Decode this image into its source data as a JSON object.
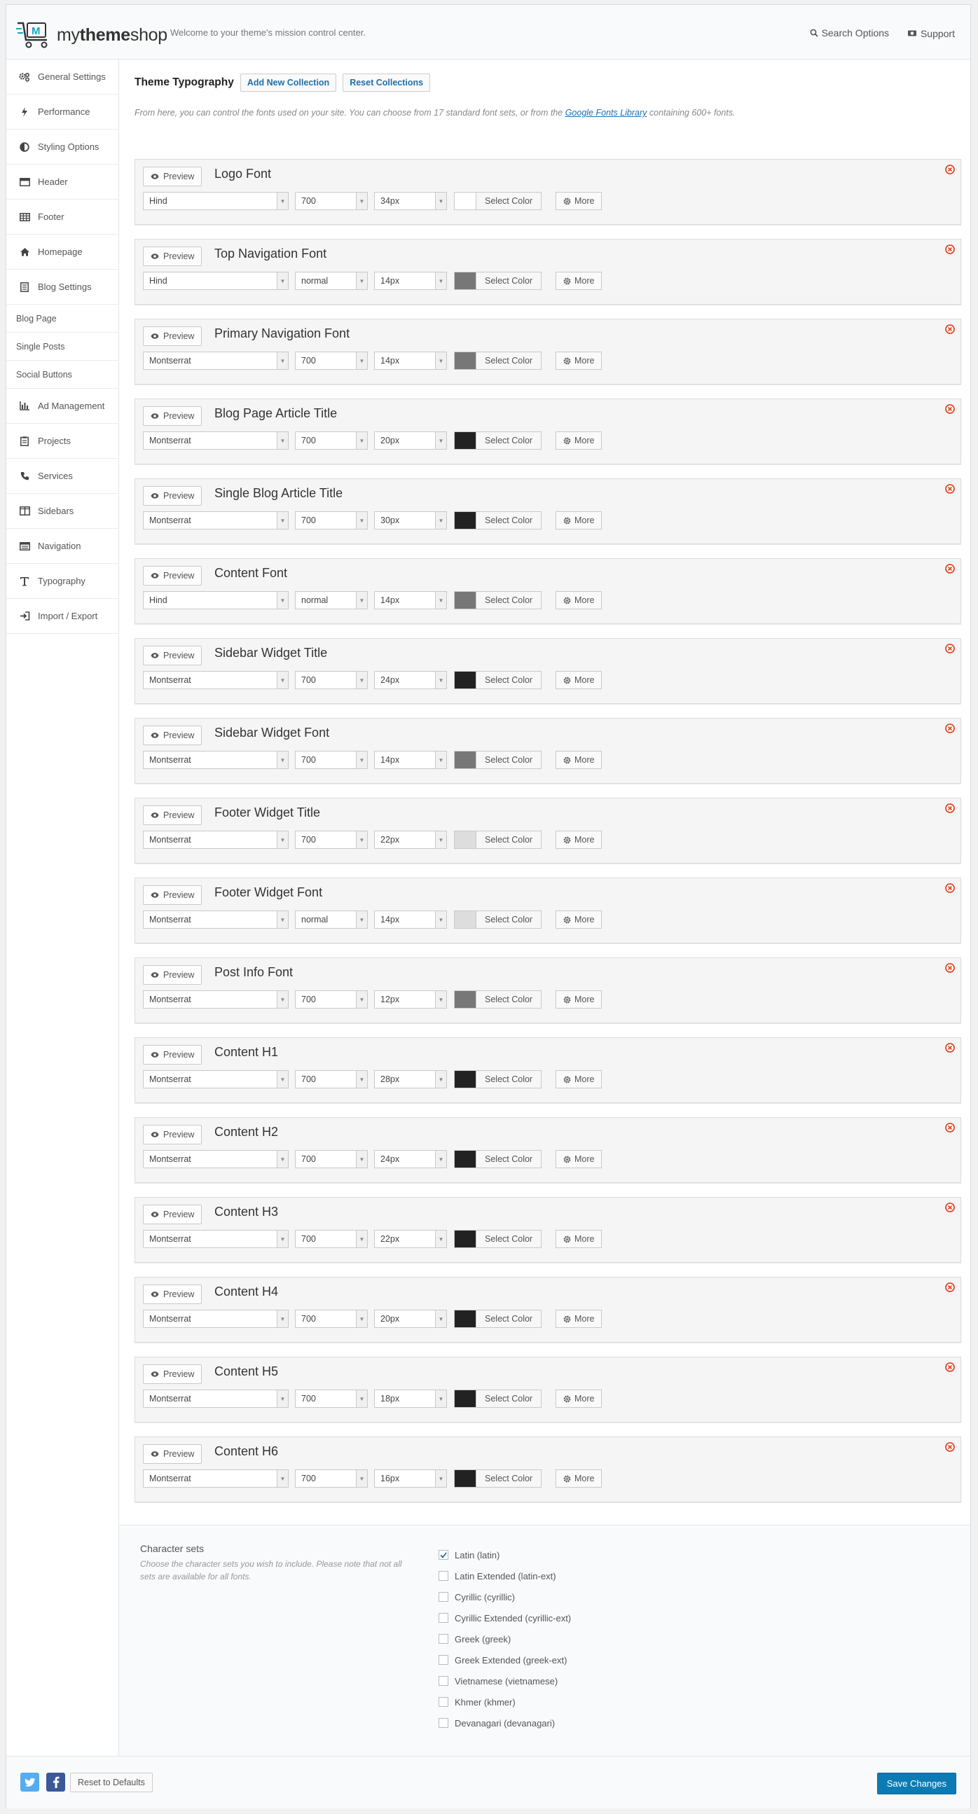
{
  "header": {
    "brand_light": "my",
    "brand_bold": "theme",
    "brand_tail": "shop",
    "welcome": "Welcome to your theme's mission control center.",
    "search_label": "Search Options",
    "support_label": "Support"
  },
  "sidebar": {
    "items": [
      {
        "label": "General Settings",
        "icon": "gears-icon"
      },
      {
        "label": "Performance",
        "icon": "bolt-icon"
      },
      {
        "label": "Styling Options",
        "icon": "contrast-icon"
      },
      {
        "label": "Header",
        "icon": "header-icon"
      },
      {
        "label": "Footer",
        "icon": "table-icon"
      },
      {
        "label": "Homepage",
        "icon": "home-icon"
      },
      {
        "label": "Blog Settings",
        "icon": "document-icon"
      },
      {
        "label": "Blog Page",
        "icon": ""
      },
      {
        "label": "Single Posts",
        "icon": ""
      },
      {
        "label": "Social Buttons",
        "icon": ""
      },
      {
        "label": "Ad Management",
        "icon": "bar-chart-icon"
      },
      {
        "label": "Projects",
        "icon": "clipboard-icon"
      },
      {
        "label": "Services",
        "icon": "phone-icon"
      },
      {
        "label": "Sidebars",
        "icon": "columns-icon"
      },
      {
        "label": "Navigation",
        "icon": "list-icon"
      },
      {
        "label": "Typography",
        "icon": "text-icon"
      },
      {
        "label": "Import / Export",
        "icon": "sign-in-icon"
      }
    ]
  },
  "main": {
    "title": "Theme Typography",
    "add_collection": "Add New Collection",
    "reset_collections": "Reset Collections",
    "intro_before": "From here, you can control the fonts used on your site. You can choose from 17 standard font sets, or from the ",
    "intro_link": "Google Fonts Library",
    "intro_after": " containing 600+ fonts.",
    "preview_label": "Preview",
    "select_color_label": "Select Color",
    "more_label": "More",
    "fonts": [
      {
        "name": "Logo Font",
        "family": "Hind",
        "weight": "700",
        "size": "34px",
        "color": "#ffffff"
      },
      {
        "name": "Top Navigation Font",
        "family": "Hind",
        "weight": "normal",
        "size": "14px",
        "color": "#777777"
      },
      {
        "name": "Primary Navigation Font",
        "family": "Montserrat",
        "weight": "700",
        "size": "14px",
        "color": "#777777"
      },
      {
        "name": "Blog Page Article Title",
        "family": "Montserrat",
        "weight": "700",
        "size": "20px",
        "color": "#222222"
      },
      {
        "name": "Single Blog Article Title",
        "family": "Montserrat",
        "weight": "700",
        "size": "30px",
        "color": "#222222"
      },
      {
        "name": "Content Font",
        "family": "Hind",
        "weight": "normal",
        "size": "14px",
        "color": "#777777"
      },
      {
        "name": "Sidebar Widget Title",
        "family": "Montserrat",
        "weight": "700",
        "size": "24px",
        "color": "#222222"
      },
      {
        "name": "Sidebar Widget Font",
        "family": "Montserrat",
        "weight": "700",
        "size": "14px",
        "color": "#777777"
      },
      {
        "name": "Footer Widget Title",
        "family": "Montserrat",
        "weight": "700",
        "size": "22px",
        "color": "#dddddd"
      },
      {
        "name": "Footer Widget Font",
        "family": "Montserrat",
        "weight": "normal",
        "size": "14px",
        "color": "#dddddd"
      },
      {
        "name": "Post Info Font",
        "family": "Montserrat",
        "weight": "700",
        "size": "12px",
        "color": "#777777"
      },
      {
        "name": "Content H1",
        "family": "Montserrat",
        "weight": "700",
        "size": "28px",
        "color": "#222222"
      },
      {
        "name": "Content H2",
        "family": "Montserrat",
        "weight": "700",
        "size": "24px",
        "color": "#222222"
      },
      {
        "name": "Content H3",
        "family": "Montserrat",
        "weight": "700",
        "size": "22px",
        "color": "#222222"
      },
      {
        "name": "Content H4",
        "family": "Montserrat",
        "weight": "700",
        "size": "20px",
        "color": "#222222"
      },
      {
        "name": "Content H5",
        "family": "Montserrat",
        "weight": "700",
        "size": "18px",
        "color": "#222222"
      },
      {
        "name": "Content H6",
        "family": "Montserrat",
        "weight": "700",
        "size": "16px",
        "color": "#222222"
      }
    ]
  },
  "charsets": {
    "title": "Character sets",
    "description": "Choose the character sets you wish to include. Please note that not all sets are available for all fonts.",
    "items": [
      {
        "label": "Latin (latin)",
        "checked": true
      },
      {
        "label": "Latin Extended (latin-ext)",
        "checked": false
      },
      {
        "label": "Cyrillic (cyrillic)",
        "checked": false
      },
      {
        "label": "Cyrillic Extended (cyrillic-ext)",
        "checked": false
      },
      {
        "label": "Greek (greek)",
        "checked": false
      },
      {
        "label": "Greek Extended (greek-ext)",
        "checked": false
      },
      {
        "label": "Vietnamese (vietnamese)",
        "checked": false
      },
      {
        "label": "Khmer (khmer)",
        "checked": false
      },
      {
        "label": "Devanagari (devanagari)",
        "checked": false
      }
    ]
  },
  "footer": {
    "reset_label": "Reset to Defaults",
    "save_label": "Save Changes",
    "twitter_color": "#55acee",
    "facebook_color": "#3b5998",
    "save_color": "#0d7bb3"
  }
}
